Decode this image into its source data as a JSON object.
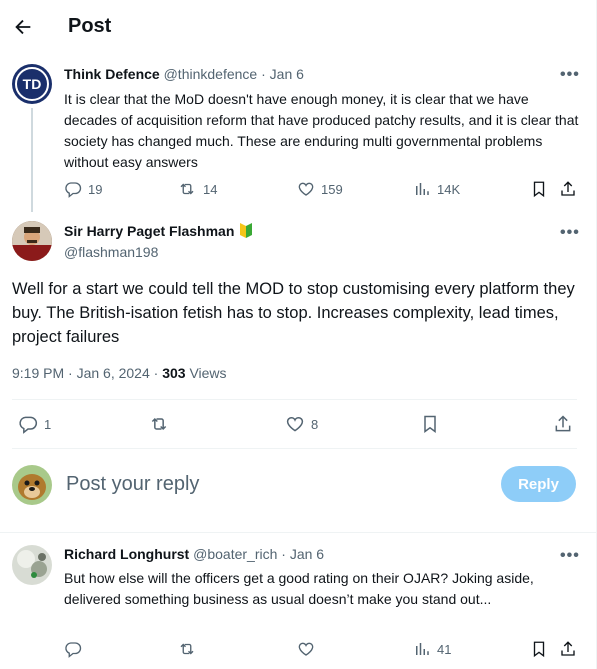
{
  "header": {
    "title": "Post"
  },
  "parent": {
    "avatar_text": "TD",
    "name": "Think Defence",
    "handle": "@thinkdefence",
    "sep": "·",
    "date": "Jan 6",
    "text": "It is clear that the MoD doesn't have enough money, it is clear that we have decades of acquisition reform that have produced patchy results, and it is clear that society has changed much. These are enduring multi governmental problems without easy answers",
    "replies": "19",
    "reposts": "14",
    "likes": "159",
    "views": "14K"
  },
  "main": {
    "name": "Sir Harry Paget Flashman",
    "handle": "@flashman198",
    "text": "Well for a start we could tell the MOD to stop customising every platform they buy. The British-isation fetish has to stop. Increases complexity, lead times, project failures",
    "time": "9:19 PM · Jan 6, 2024 · ",
    "view_count": "303",
    "views_label": " Views",
    "replies": "1",
    "likes": "8"
  },
  "compose": {
    "placeholder": "Post your reply",
    "button": "Reply"
  },
  "reply": {
    "name": "Richard Longhurst",
    "handle": "@boater_rich",
    "sep": "·",
    "date": "Jan 6",
    "text": "But how else will the officers get a good rating on their OJAR? Joking aside, delivered something business as usual doesn’t make you stand out...",
    "views": "41"
  },
  "colors": {
    "accent": "#1d9bf0",
    "reply_button_disabled": "#8ecdf8",
    "muted": "#536471",
    "td_blue": "#1a2f6b"
  }
}
